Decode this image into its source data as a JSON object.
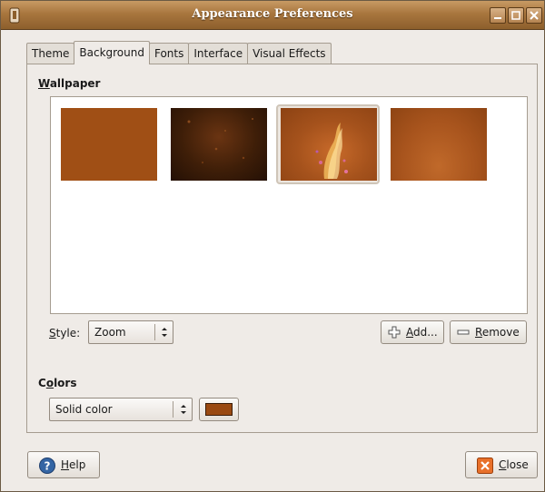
{
  "window": {
    "title": "Appearance Preferences"
  },
  "tabs": [
    {
      "label": "Theme"
    },
    {
      "label": "Background",
      "active": true
    },
    {
      "label": "Fonts"
    },
    {
      "label": "Interface"
    },
    {
      "label": "Visual Effects"
    }
  ],
  "wallpaper": {
    "heading_mnemonic": "W",
    "heading_rest": "allpaper",
    "selected_index": 2,
    "thumbnails": [
      {
        "color": "#a04f15"
      },
      {
        "color": "#3e1e08"
      },
      {
        "color": "#a5521c"
      },
      {
        "color": "#a8541d"
      }
    ]
  },
  "style": {
    "label_mnemonic": "S",
    "label_rest": "tyle:",
    "value": "Zoom"
  },
  "buttons": {
    "add": {
      "mnemonic": "A",
      "rest": "dd..."
    },
    "remove": {
      "mnemonic": "R",
      "rest": "emove"
    },
    "help": {
      "mnemonic": "H",
      "rest": "elp"
    },
    "close": {
      "mnemonic": "C",
      "rest": "lose"
    }
  },
  "colors": {
    "heading_pre": "C",
    "heading_mnemonic": "o",
    "heading_rest": "lors",
    "mode": "Solid color",
    "swatch": "#9a4a12"
  }
}
